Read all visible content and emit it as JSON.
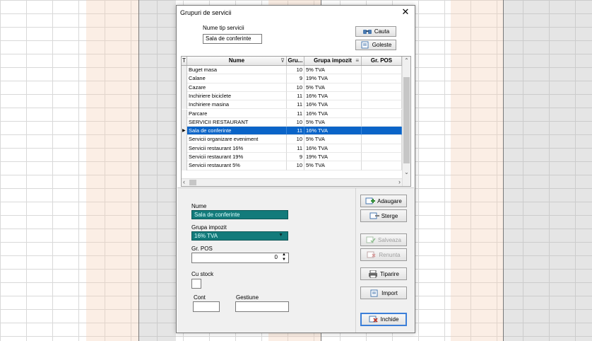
{
  "dialog": {
    "title": "Grupuri de servicii",
    "search": {
      "label": "Nume tip servicii",
      "value": "Sala de conferinte"
    },
    "buttons": {
      "search": "Cauta",
      "clear": "Goleste"
    }
  },
  "grid": {
    "headers": {
      "filter": "T",
      "name": "Nume",
      "group_num": "Gru...",
      "tax_group": "Grupa impozit",
      "pos": "Gr. POS"
    },
    "rows": [
      {
        "name": "Buget masa",
        "num": "10",
        "tax": "5% TVA"
      },
      {
        "name": "Calane",
        "num": "9",
        "tax": "19% TVA"
      },
      {
        "name": "Cazare",
        "num": "10",
        "tax": "5% TVA"
      },
      {
        "name": "Inchiriere biciclete",
        "num": "11",
        "tax": "16% TVA"
      },
      {
        "name": "Inchiriere masina",
        "num": "11",
        "tax": "16% TVA"
      },
      {
        "name": "Parcare",
        "num": "11",
        "tax": "16% TVA"
      },
      {
        "name": "SERVICII RESTAURANT",
        "num": "10",
        "tax": "5% TVA"
      },
      {
        "name": "Sala de conferinte",
        "num": "11",
        "tax": "16% TVA"
      },
      {
        "name": "Servicii organizare eveniment",
        "num": "10",
        "tax": "5% TVA"
      },
      {
        "name": "Servicii restaurant 16%",
        "num": "11",
        "tax": "16% TVA"
      },
      {
        "name": "Servicii restaurant 19%",
        "num": "9",
        "tax": "19% TVA"
      },
      {
        "name": "Servicii restaurant 5%",
        "num": "10",
        "tax": "5% TVA"
      }
    ],
    "selected_index": 7
  },
  "form": {
    "name_label": "Nume",
    "name_value": "Sala de conferinte",
    "tax_label": "Grupa impozit",
    "tax_value": "16% TVA",
    "pos_label": "Gr. POS",
    "pos_value": "0",
    "stock_label": "Cu stock",
    "cont_label": "Cont",
    "gestiune_label": "Gestiune"
  },
  "actions": {
    "add": "Adaugare",
    "delete": "Sterge",
    "save": "Salveaza",
    "cancel": "Renunta",
    "print": "Tiparire",
    "import": "Import",
    "close": "Inchide"
  },
  "colors": {
    "selection": "#0a64c8",
    "field_teal": "#137b7b",
    "accent_green": "#2e8b2e",
    "accent_red": "#c0392b"
  }
}
